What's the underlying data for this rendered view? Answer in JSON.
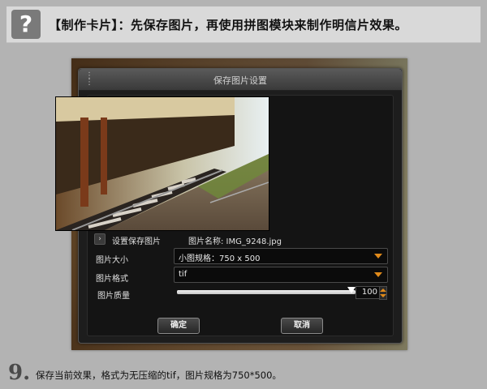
{
  "header": {
    "icon": "question-icon",
    "icon_glyph": "?",
    "text": "【制作卡片】：先保存图片，再使用拼图模块来制作明信片效果。"
  },
  "dialog": {
    "title": "保存图片设置",
    "section_label": "设置保存图片",
    "file_name_label": "图片名称: IMG_9248.jpg",
    "rows": {
      "size": {
        "label": "图片大小",
        "value": "小图规格：750 x 500"
      },
      "format": {
        "label": "图片格式",
        "value": "tif"
      },
      "quality": {
        "label": "图片质量",
        "value": "100",
        "level": 1.0
      }
    },
    "buttons": {
      "ok": "确定",
      "cancel": "取消"
    }
  },
  "caption": {
    "step": "9.",
    "text": "保存当前效果，格式为无压缩的tif，图片规格为750*500。"
  },
  "colors": {
    "accent": "#e08a1a",
    "dialog_bg": "#1d1d1d",
    "page_bg": "#b3b3b3"
  }
}
